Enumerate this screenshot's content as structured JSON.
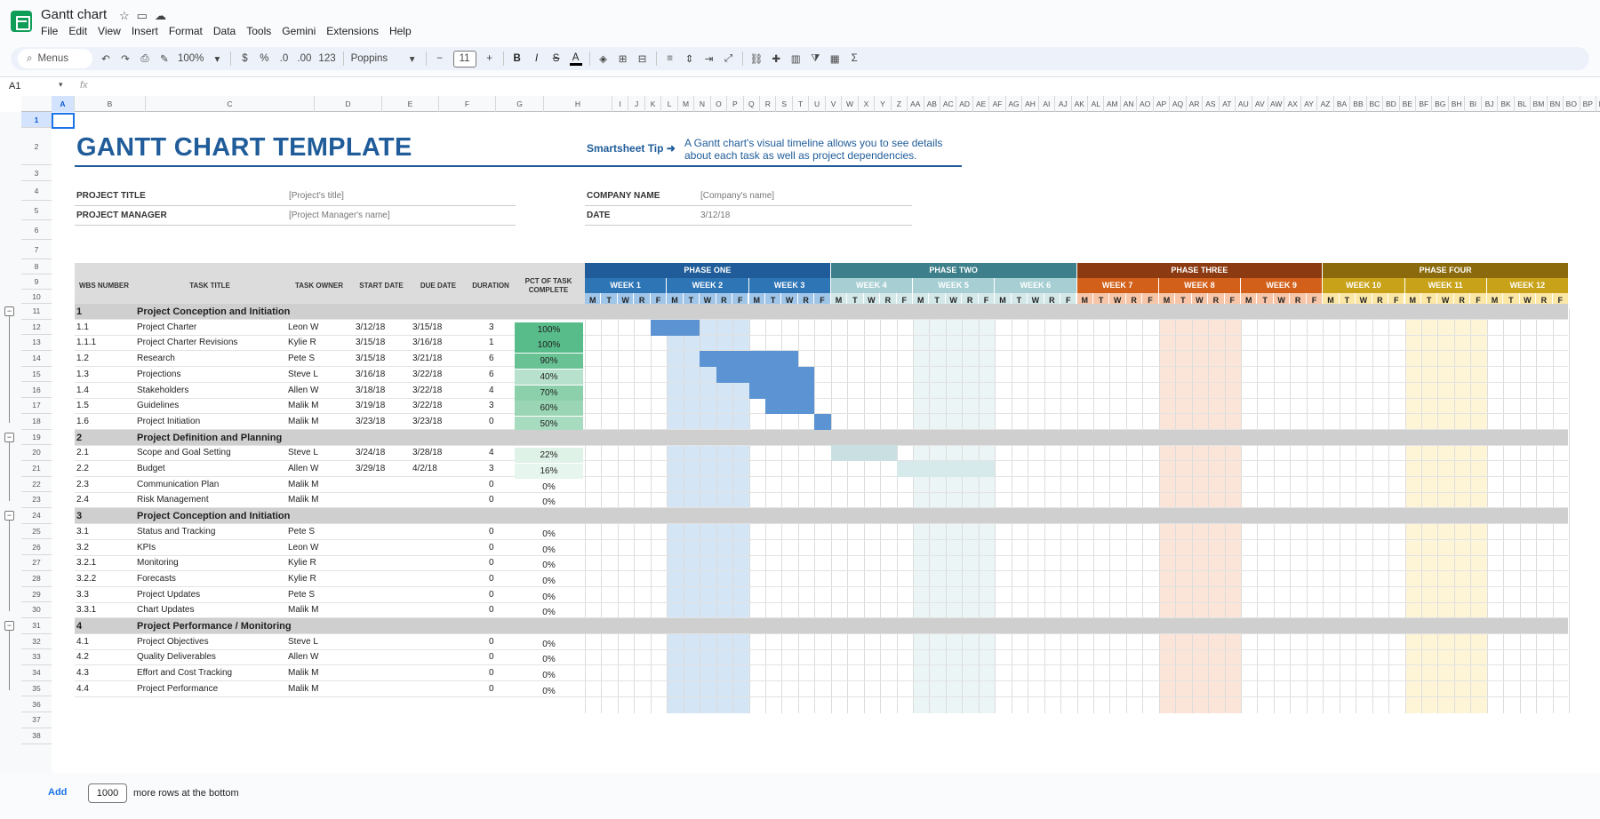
{
  "app": {
    "title": "Gantt chart"
  },
  "menu": [
    "File",
    "Edit",
    "View",
    "Insert",
    "Format",
    "Data",
    "Tools",
    "Gemini",
    "Extensions",
    "Help"
  ],
  "toolbar": {
    "search": "Menus",
    "zoom": "100%",
    "currency": "$",
    "percent": "%",
    "dec_less": ".0",
    "dec_more": ".00",
    "number_format": "123",
    "font": "Poppins",
    "font_size": "11",
    "minus": "−",
    "plus": "+",
    "bold": "B",
    "italic": "I",
    "strike": "S",
    "text_color": "A",
    "sigma": "Σ"
  },
  "formula_bar": {
    "cell": "A1",
    "fx": "fx"
  },
  "columns": [
    "A",
    "B",
    "C",
    "D",
    "E",
    "F",
    "G",
    "H",
    "I",
    "J",
    "K",
    "L",
    "M",
    "N",
    "O",
    "P",
    "Q",
    "R",
    "S",
    "T",
    "U",
    "V",
    "W",
    "X",
    "Y",
    "Z",
    "AA",
    "AB",
    "AC",
    "AD",
    "AE",
    "AF",
    "AG",
    "AH",
    "AI",
    "AJ",
    "AK",
    "AL",
    "AM",
    "AN",
    "AO",
    "AP",
    "AQ",
    "AR",
    "AS",
    "AT",
    "AU",
    "AV",
    "AW",
    "AX",
    "AY",
    "AZ",
    "BA",
    "BB",
    "BC",
    "BD",
    "BE",
    "BF",
    "BG",
    "BH",
    "BI",
    "BJ",
    "BK",
    "BL",
    "BM",
    "BN",
    "BO",
    "BP",
    "BQ"
  ],
  "rows": [
    "1",
    "2",
    "3",
    "4",
    "5",
    "6",
    "7",
    "8",
    "9",
    "10",
    "11",
    "12",
    "13",
    "14",
    "15",
    "16",
    "17",
    "18",
    "19",
    "20",
    "21",
    "22",
    "23",
    "24",
    "25",
    "26",
    "27",
    "28",
    "29",
    "30",
    "31",
    "32",
    "33",
    "34",
    "35",
    "36",
    "37",
    "38"
  ],
  "sheet": {
    "title": "GANTT CHART TEMPLATE",
    "tip_label": "Smartsheet Tip ➜",
    "tip_text": "A Gantt chart's visual timeline allows you to see details about each task as well as project dependencies.",
    "project_title_label": "PROJECT TITLE",
    "project_title_value": "[Project's title]",
    "project_manager_label": "PROJECT MANAGER",
    "project_manager_value": "[Project Manager's name]",
    "company_label": "COMPANY NAME",
    "company_value": "[Company's name]",
    "date_label": "DATE",
    "date_value": "3/12/18"
  },
  "table_headers": [
    "WBS NUMBER",
    "TASK TITLE",
    "TASK OWNER",
    "START DATE",
    "DUE DATE",
    "DURATION",
    "PCT OF TASK COMPLETE"
  ],
  "phases": [
    {
      "name": "PHASE ONE",
      "color": "#1f5c99",
      "week_color": "#2e75b6",
      "day_color": "#9fc5e8",
      "weeks": [
        "WEEK 1",
        "WEEK 2",
        "WEEK 3"
      ]
    },
    {
      "name": "PHASE TWO",
      "color": "#3d7f8a",
      "week_color": "#a7cfd3",
      "day_color": "#d4e8ea",
      "weeks": [
        "WEEK 4",
        "WEEK 5",
        "WEEK 6"
      ]
    },
    {
      "name": "PHASE THREE",
      "color": "#8b3a12",
      "week_color": "#d2601a",
      "day_color": "#f7c6a8",
      "weeks": [
        "WEEK 7",
        "WEEK 8",
        "WEEK 9"
      ]
    },
    {
      "name": "PHASE FOUR",
      "color": "#8a6a0c",
      "week_color": "#c8a31a",
      "day_color": "#fce8a6",
      "weeks": [
        "WEEK 10",
        "WEEK 11",
        "WEEK 12"
      ]
    }
  ],
  "days": [
    "M",
    "T",
    "W",
    "R",
    "F"
  ],
  "tasks": [
    {
      "type": "section",
      "wbs": "1",
      "title": "Project Conception and Initiation"
    },
    {
      "type": "task",
      "wbs": "1.1",
      "title": "Project Charter",
      "owner": "Leon W",
      "start": "3/12/18",
      "due": "3/15/18",
      "duration": "3",
      "pct": "100%",
      "bar_start": 4,
      "bar_len": 3,
      "bar_color": "#5b93d3",
      "pct_color": "#57bb8a"
    },
    {
      "type": "task",
      "wbs": "1.1.1",
      "title": "Project Charter Revisions",
      "owner": "Kylie R",
      "start": "3/15/18",
      "due": "3/16/18",
      "duration": "1",
      "pct": "100%",
      "bar_start": 7,
      "bar_len": 0,
      "bar_color": "#5b93d3",
      "pct_color": "#57bb8a"
    },
    {
      "type": "task",
      "wbs": "1.2",
      "title": "Research",
      "owner": "Pete S",
      "start": "3/15/18",
      "due": "3/21/18",
      "duration": "6",
      "pct": "90%",
      "bar_start": 7,
      "bar_len": 6,
      "bar_color": "#5b93d3",
      "pct_color": "#68c294"
    },
    {
      "type": "task",
      "wbs": "1.3",
      "title": "Projections",
      "owner": "Steve L",
      "start": "3/16/18",
      "due": "3/22/18",
      "duration": "6",
      "pct": "40%",
      "bar_start": 8,
      "bar_len": 6,
      "bar_color": "#5b93d3",
      "pct_color": "#b7e1cd"
    },
    {
      "type": "task",
      "wbs": "1.4",
      "title": "Stakeholders",
      "owner": "Allen W",
      "start": "3/18/18",
      "due": "3/22/18",
      "duration": "4",
      "pct": "70%",
      "bar_start": 10,
      "bar_len": 4,
      "bar_color": "#5b93d3",
      "pct_color": "#8cd0ab"
    },
    {
      "type": "task",
      "wbs": "1.5",
      "title": "Guidelines",
      "owner": "Malik M",
      "start": "3/19/18",
      "due": "3/22/18",
      "duration": "3",
      "pct": "60%",
      "bar_start": 11,
      "bar_len": 3,
      "bar_color": "#5b93d3",
      "pct_color": "#9ad6b5"
    },
    {
      "type": "task",
      "wbs": "1.6",
      "title": "Project Initiation",
      "owner": "Malik M",
      "start": "3/23/18",
      "due": "3/23/18",
      "duration": "0",
      "pct": "50%",
      "bar_start": 14,
      "bar_len": 1,
      "bar_color": "#5b93d3",
      "pct_color": "#a8dcc0"
    },
    {
      "type": "section",
      "wbs": "2",
      "title": "Project Definition and Planning"
    },
    {
      "type": "task",
      "wbs": "2.1",
      "title": "Scope and Goal Setting",
      "owner": "Steve L",
      "start": "3/24/18",
      "due": "3/28/18",
      "duration": "4",
      "pct": "22%",
      "bar_start": 15,
      "bar_len": 4,
      "bar_color": "#c9dfe2",
      "pct_color": "#dff2e8"
    },
    {
      "type": "task",
      "wbs": "2.2",
      "title": "Budget",
      "owner": "Allen W",
      "start": "3/29/18",
      "due": "4/2/18",
      "duration": "3",
      "pct": "16%",
      "bar_start": 19,
      "bar_len": 6,
      "bar_color": "#d6e9eb",
      "pct_color": "#e6f5ee"
    },
    {
      "type": "task",
      "wbs": "2.3",
      "title": "Communication Plan",
      "owner": "Malik M",
      "start": "",
      "due": "",
      "duration": "0",
      "pct": "0%"
    },
    {
      "type": "task",
      "wbs": "2.4",
      "title": "Risk Management",
      "owner": "Malik M",
      "start": "",
      "due": "",
      "duration": "0",
      "pct": "0%"
    },
    {
      "type": "section",
      "wbs": "3",
      "title": "Project Conception and Initiation"
    },
    {
      "type": "task",
      "wbs": "3.1",
      "title": "Status and Tracking",
      "owner": "Pete S",
      "start": "",
      "due": "",
      "duration": "0",
      "pct": "0%"
    },
    {
      "type": "task",
      "wbs": "3.2",
      "title": "KPIs",
      "owner": "Leon W",
      "start": "",
      "due": "",
      "duration": "0",
      "pct": "0%"
    },
    {
      "type": "task",
      "wbs": "3.2.1",
      "title": "Monitoring",
      "owner": "Kylie R",
      "start": "",
      "due": "",
      "duration": "0",
      "pct": "0%"
    },
    {
      "type": "task",
      "wbs": "3.2.2",
      "title": "Forecasts",
      "owner": "Kylie R",
      "start": "",
      "due": "",
      "duration": "0",
      "pct": "0%"
    },
    {
      "type": "task",
      "wbs": "3.3",
      "title": "Project Updates",
      "owner": "Pete S",
      "start": "",
      "due": "",
      "duration": "0",
      "pct": "0%"
    },
    {
      "type": "task",
      "wbs": "3.3.1",
      "title": "Chart Updates",
      "owner": "Malik M",
      "start": "",
      "due": "",
      "duration": "0",
      "pct": "0%"
    },
    {
      "type": "section",
      "wbs": "4",
      "title": "Project Performance / Monitoring"
    },
    {
      "type": "task",
      "wbs": "4.1",
      "title": "Project Objectives",
      "owner": "Steve L",
      "start": "",
      "due": "",
      "duration": "0",
      "pct": "0%"
    },
    {
      "type": "task",
      "wbs": "4.2",
      "title": "Quality Deliverables",
      "owner": "Allen W",
      "start": "",
      "due": "",
      "duration": "0",
      "pct": "0%"
    },
    {
      "type": "task",
      "wbs": "4.3",
      "title": "Effort and Cost Tracking",
      "owner": "Malik M",
      "start": "",
      "due": "",
      "duration": "0",
      "pct": "0%"
    },
    {
      "type": "task",
      "wbs": "4.4",
      "title": "Project Performance",
      "owner": "Malik M",
      "start": "",
      "due": "",
      "duration": "0",
      "pct": "0%"
    }
  ],
  "bottom": {
    "add_label": "Add",
    "add_count": "1000",
    "add_text": "more rows at the bottom"
  }
}
